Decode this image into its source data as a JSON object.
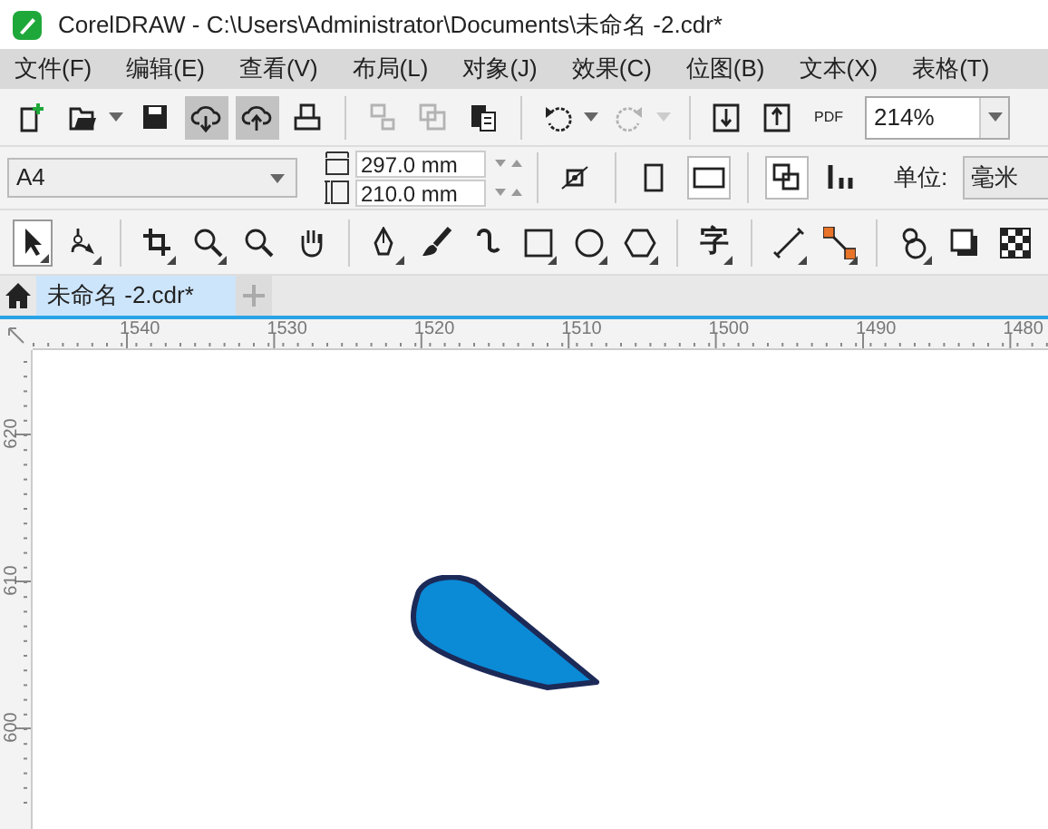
{
  "window": {
    "title": "CorelDRAW - C:\\Users\\Administrator\\Documents\\未命名 -2.cdr*"
  },
  "menu": [
    "文件(F)",
    "编辑(E)",
    "查看(V)",
    "布局(L)",
    "对象(J)",
    "效果(C)",
    "位图(B)",
    "文本(X)",
    "表格(T)"
  ],
  "standard_toolbar": [
    [
      {
        "kind": "new",
        "pressed": false,
        "disabled": false,
        "dropdown": false
      },
      {
        "kind": "open",
        "pressed": false,
        "disabled": false,
        "dropdown": true
      },
      {
        "kind": "save",
        "pressed": false,
        "disabled": false,
        "dropdown": false
      },
      {
        "kind": "cloud-down",
        "pressed": true,
        "disabled": false,
        "dropdown": false
      },
      {
        "kind": "cloud-up",
        "pressed": true,
        "disabled": false,
        "dropdown": false
      },
      {
        "kind": "print",
        "pressed": false,
        "disabled": false,
        "dropdown": false
      }
    ],
    [
      {
        "kind": "cut",
        "pressed": false,
        "disabled": true,
        "dropdown": false
      },
      {
        "kind": "copy",
        "pressed": false,
        "disabled": true,
        "dropdown": false
      },
      {
        "kind": "paste",
        "pressed": false,
        "disabled": false,
        "dropdown": false
      }
    ],
    [
      {
        "kind": "undo",
        "pressed": false,
        "disabled": false,
        "dropdown": true
      },
      {
        "kind": "redo",
        "pressed": false,
        "disabled": true,
        "dropdown": true
      }
    ],
    [
      {
        "kind": "import",
        "pressed": false,
        "disabled": false,
        "dropdown": false
      },
      {
        "kind": "export",
        "pressed": false,
        "disabled": false,
        "dropdown": false
      },
      {
        "kind": "pdf",
        "label": "PDF",
        "pressed": false,
        "disabled": false,
        "dropdown": false
      }
    ]
  ],
  "zoom": {
    "value": "214%"
  },
  "property_bar": {
    "page_size": "A4",
    "width": "297.0 mm",
    "height": "210.0 mm",
    "groups": [
      [
        {
          "kind": "origin",
          "pressed": false
        }
      ],
      [
        {
          "kind": "portrait",
          "pressed": false
        },
        {
          "kind": "landscape",
          "pressed": true
        }
      ],
      [
        {
          "kind": "all-pages",
          "pressed": true
        },
        {
          "kind": "current-page",
          "pressed": false
        }
      ]
    ],
    "units_label": "单位:",
    "units": "毫米"
  },
  "toolbox": [
    [
      {
        "kind": "pick",
        "selected": true,
        "flyout": true
      },
      {
        "kind": "shape",
        "selected": false,
        "flyout": true
      }
    ],
    [
      {
        "kind": "crop",
        "selected": false,
        "flyout": true
      },
      {
        "kind": "zoom",
        "selected": false,
        "flyout": true
      },
      {
        "kind": "zoom",
        "selected": false,
        "flyout": false
      },
      {
        "kind": "pan",
        "selected": false,
        "flyout": false
      }
    ],
    [
      {
        "kind": "pen",
        "selected": false,
        "flyout": true
      },
      {
        "kind": "brush",
        "selected": false,
        "flyout": false
      },
      {
        "kind": "curl",
        "selected": false,
        "flyout": false
      },
      {
        "kind": "rectangle",
        "selected": false,
        "flyout": true
      },
      {
        "kind": "ellipse",
        "selected": false,
        "flyout": true
      },
      {
        "kind": "polygon",
        "selected": false,
        "flyout": true
      }
    ],
    [
      {
        "kind": "text",
        "label": "字",
        "selected": false,
        "flyout": true
      }
    ],
    [
      {
        "kind": "dimension",
        "selected": false,
        "flyout": true
      },
      {
        "kind": "connector",
        "selected": false,
        "flyout": true
      }
    ],
    [
      {
        "kind": "blend",
        "selected": false,
        "flyout": true
      },
      {
        "kind": "shadow",
        "selected": false,
        "flyout": false
      },
      {
        "kind": "transparency",
        "selected": false,
        "flyout": false
      }
    ]
  ],
  "tabs": [
    {
      "label": "未命名 -2.cdr*",
      "selected": true
    }
  ],
  "horizontal_ruler": {
    "labels": [
      "1540",
      "1530",
      "1520",
      "1510",
      "1500",
      "1490",
      "1480"
    ]
  },
  "vertical_ruler": {
    "labels": [
      "620",
      "610",
      "600"
    ]
  }
}
